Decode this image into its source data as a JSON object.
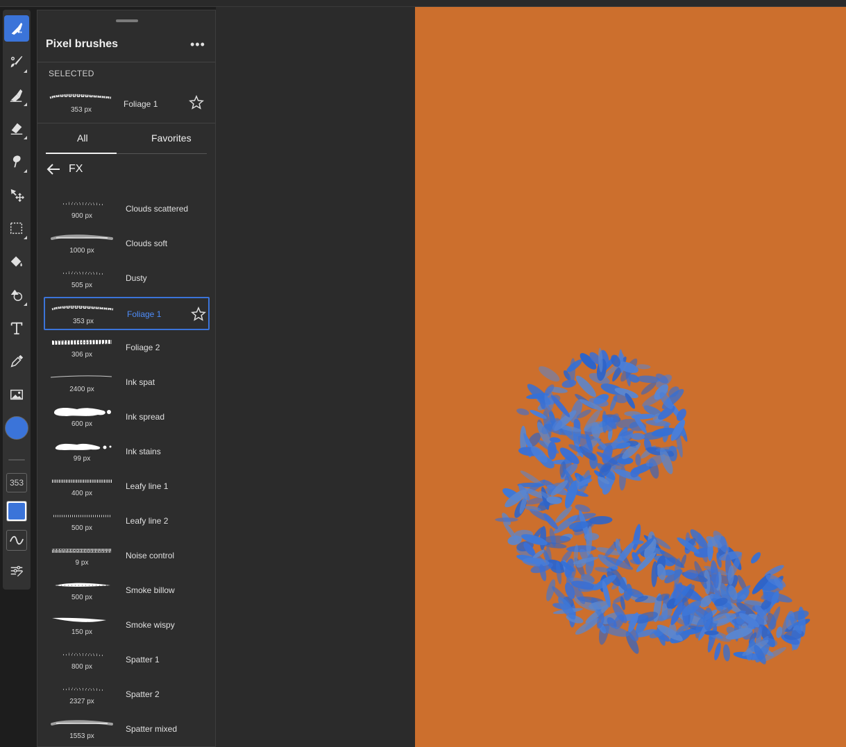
{
  "panel": {
    "title": "Pixel brushes",
    "more_icon": "more-horizontal-icon",
    "selected_label": "SELECTED",
    "selected_brush": {
      "name": "Foliage 1",
      "size": "353 px"
    },
    "tabs": [
      {
        "label": "All",
        "active": true
      },
      {
        "label": "Favorites",
        "active": false
      }
    ],
    "category": "FX",
    "brushes": [
      {
        "name": "Clouds scattered",
        "size": "900 px",
        "stroke": "dots-faint"
      },
      {
        "name": "Clouds soft",
        "size": "1000 px",
        "stroke": "soft"
      },
      {
        "name": "Dusty",
        "size": "505 px",
        "stroke": "dots-faint"
      },
      {
        "name": "Foliage 1",
        "size": "353 px",
        "stroke": "textured",
        "selected": true
      },
      {
        "name": "Foliage 2",
        "size": "306 px",
        "stroke": "foliage"
      },
      {
        "name": "Ink spat",
        "size": "2400 px",
        "stroke": "thin"
      },
      {
        "name": "Ink spread",
        "size": "600 px",
        "stroke": "blob"
      },
      {
        "name": "Ink stains",
        "size": "99 px",
        "stroke": "blob-small"
      },
      {
        "name": "Leafy line 1",
        "size": "400 px",
        "stroke": "leafy"
      },
      {
        "name": "Leafy line 2",
        "size": "500 px",
        "stroke": "leafy-light"
      },
      {
        "name": "Noise control",
        "size": "9 px",
        "stroke": "noise"
      },
      {
        "name": "Smoke billow",
        "size": "500 px",
        "stroke": "smoke"
      },
      {
        "name": "Smoke wispy",
        "size": "150 px",
        "stroke": "wispy"
      },
      {
        "name": "Spatter 1",
        "size": "800 px",
        "stroke": "dots-faint"
      },
      {
        "name": "Spatter 2",
        "size": "2327 px",
        "stroke": "dots-faint"
      },
      {
        "name": "Spatter mixed",
        "size": "1553 px",
        "stroke": "soft"
      }
    ]
  },
  "toolbar": {
    "tools": [
      "pixel-brush-icon",
      "paint-brush-icon",
      "fill-brush-icon",
      "eraser-icon",
      "smudge-icon",
      "move-icon",
      "marquee-icon",
      "paint-bucket-icon",
      "shape-icon",
      "text-icon",
      "eyedropper-icon",
      "image-icon"
    ],
    "color": "#3b74d9",
    "brush_size": "353"
  },
  "colors": {
    "canvas": "#cc6f2d",
    "accent": "#3b74d9",
    "leaves": "#3d6fd0"
  }
}
